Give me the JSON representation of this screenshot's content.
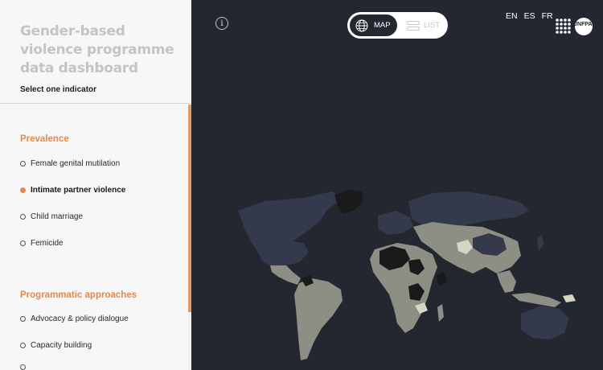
{
  "sidebar": {
    "title": "Gender-based violence programme data dashboard",
    "select_label": "Select one indicator",
    "sections": [
      {
        "heading": "Prevalence",
        "items": [
          {
            "label": "Female genital mutilation",
            "selected": false
          },
          {
            "label": "Intimate partner violence",
            "selected": true
          },
          {
            "label": "Child marriage",
            "selected": false
          },
          {
            "label": "Femicide",
            "selected": false
          }
        ]
      },
      {
        "heading": "Programmatic approaches",
        "items": [
          {
            "label": "Advocacy & policy dialogue",
            "selected": false
          },
          {
            "label": "Capacity building",
            "selected": false
          }
        ]
      }
    ]
  },
  "header": {
    "info_symbol": "i",
    "view_toggle": {
      "map_label": "MAP",
      "list_label": "LIST",
      "active": "MAP"
    },
    "languages": [
      "EN",
      "ES",
      "FR"
    ],
    "logo_text": "UNFPA"
  },
  "icons": {
    "globe": "globe-icon",
    "list": "list-icon",
    "info": "info-icon"
  },
  "colors": {
    "accent": "#e0894f",
    "map_background": "#23272f",
    "land_gray": "#8d8f85",
    "land_no_data": "#343a4c",
    "land_dark": "#1a1a1a",
    "land_light": "#d6d6c2"
  }
}
